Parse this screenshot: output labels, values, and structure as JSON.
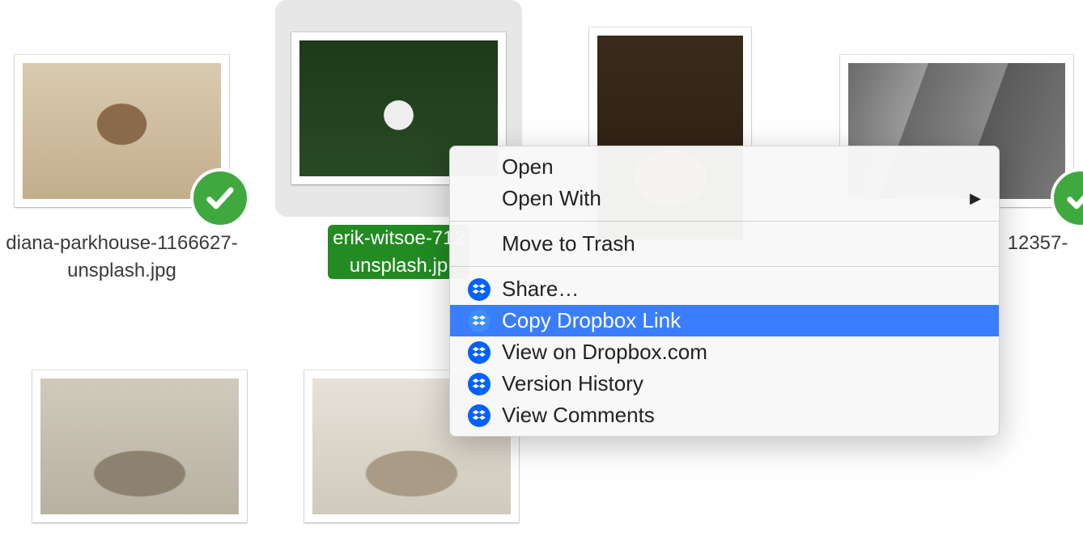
{
  "files": [
    {
      "name": "diana-parkhouse-1166627-\nunsplash.jpg",
      "selected": false,
      "synced": true
    },
    {
      "name": "erik-witsoe-712\nunsplash.jp",
      "selected": true,
      "synced": false
    },
    {
      "name": "",
      "selected": false,
      "synced": false
    },
    {
      "name": "12357-",
      "selected": false,
      "synced": true
    },
    {
      "name": "",
      "selected": false,
      "synced": false
    },
    {
      "name": "",
      "selected": false,
      "synced": false
    }
  ],
  "context_menu": {
    "open": "Open",
    "open_with": "Open With",
    "move_to_trash": "Move to Trash",
    "share": "Share…",
    "copy_link": "Copy Dropbox Link",
    "view_on_dropbox": "View on Dropbox.com",
    "version_history": "Version History",
    "view_comments": "View Comments",
    "highlighted": "copy_link"
  },
  "colors": {
    "sync_green": "#3fa93f",
    "menu_highlight": "#3a7dff",
    "dropbox_blue": "#0061ff",
    "selection_green": "#228b22"
  }
}
